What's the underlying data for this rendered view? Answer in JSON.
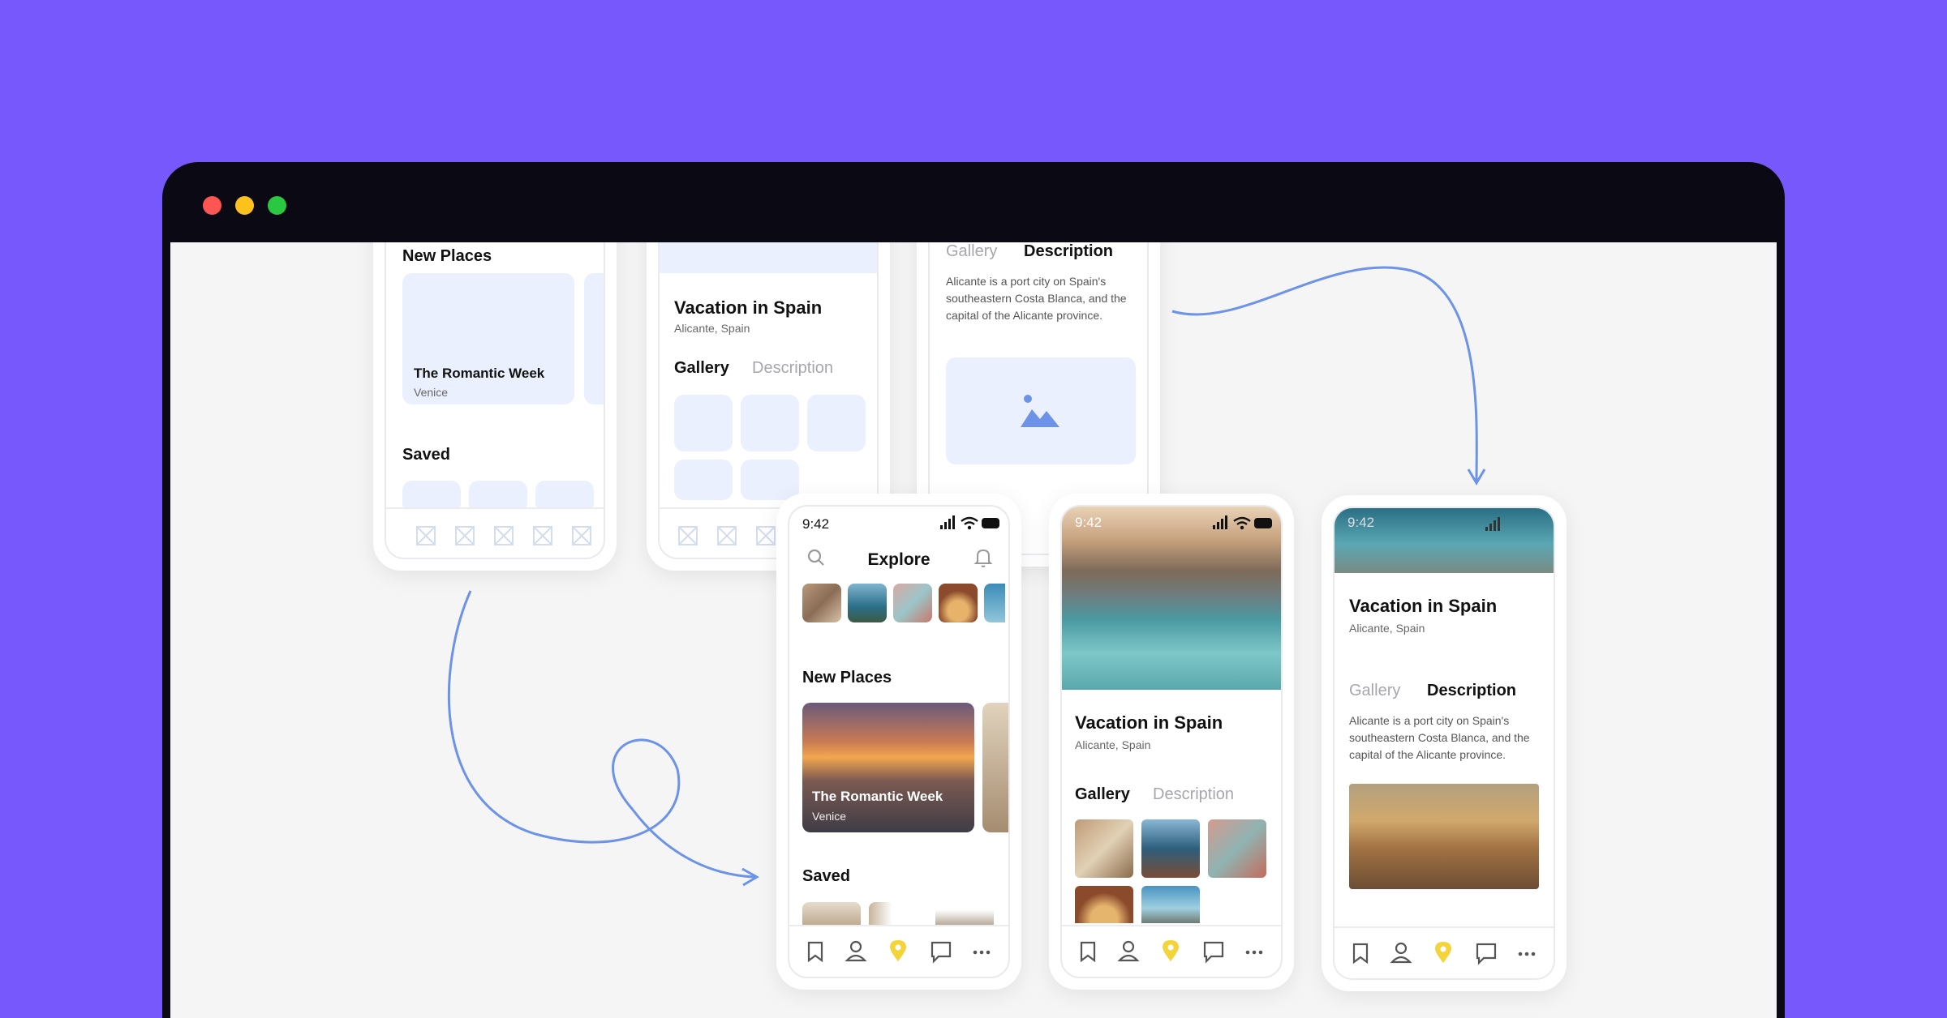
{
  "window": {
    "controls": [
      {
        "name": "close",
        "color": "#fd5553"
      },
      {
        "name": "minimize",
        "color": "#fdc11d"
      },
      {
        "name": "maximize",
        "color": "#2ac840"
      }
    ]
  },
  "wireframe_home": {
    "section_new": "New Places",
    "card_title": "The Romantic Week",
    "card_sub": "Venice",
    "section_saved": "Saved"
  },
  "wireframe_detail": {
    "title": "Vacation in Spain",
    "location": "Alicante, Spain",
    "tab_gallery": "Gallery",
    "tab_description": "Description"
  },
  "wireframe_description": {
    "tab_gallery": "Gallery",
    "tab_description": "Description",
    "text": "Alicante is a port city on Spain's southeastern Costa Blanca, and the capital of the Alicante province."
  },
  "explore_screen": {
    "time": "9:42",
    "title": "Explore",
    "section_new": "New Places",
    "card_title": "The Romantic Week",
    "card_sub": "Venice",
    "section_saved": "Saved"
  },
  "gallery_screen": {
    "time": "9:42",
    "title": "Vacation in Spain",
    "location": "Alicante, Spain",
    "tab_gallery": "Gallery",
    "tab_description": "Description"
  },
  "description_screen": {
    "time": "9:42",
    "title": "Vacation in Spain",
    "location": "Alicante, Spain",
    "tab_gallery": "Gallery",
    "tab_description": "Description",
    "text": "Alicante is a port city on Spain's southeastern Costa Blanca, and the capital of the Alicante province."
  },
  "tabbar_icons": [
    "bookmark-icon",
    "profile-icon",
    "location-pin-icon",
    "chat-icon",
    "more-icon"
  ],
  "colors": {
    "background": "#7658fd",
    "accent_pin": "#f5d33a",
    "connector": "#6d93e8",
    "placeholder": "#eaf0fd"
  }
}
